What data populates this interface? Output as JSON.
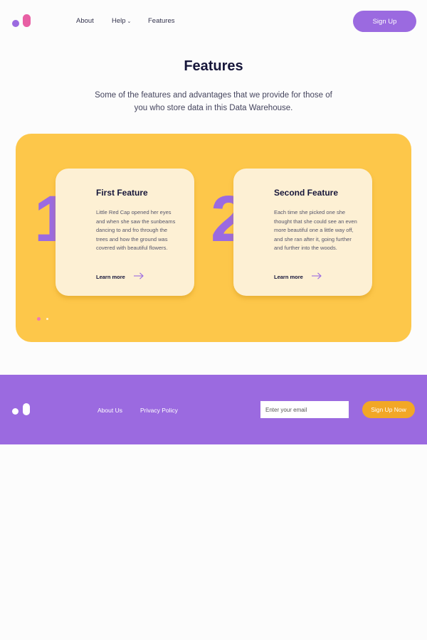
{
  "colors": {
    "purple": "#9b6ae0",
    "pink": "#e85fa4",
    "yellow": "#fdc74a",
    "card": "#fdf0d4",
    "orange": "#f2a726",
    "dot_pink": "#f07ab2",
    "dot_light": "#fff3d6"
  },
  "header": {
    "logo_icon": "logo-icon",
    "nav": [
      "About",
      "Help",
      "Features"
    ],
    "help_icon": "chevron-down-icon",
    "signup_label": "Sign Up"
  },
  "features": {
    "title": "Features",
    "subtitle": "Some of the features and advantages that we provide for those of you who store data in this Data Warehouse.",
    "cards": [
      {
        "number": "1",
        "title": "First Feature",
        "text": "Little Red Cap opened her eyes and when she saw the sunbeams dancing to and fro through the trees and how the ground was covered with beautiful flowers.",
        "link": "Learn more",
        "link_icon": "arrow-right-icon"
      },
      {
        "number": "2",
        "title": "Second Feature",
        "text": "Each time she picked one she thought that she could see an even more beautiful one a little way off, and she ran after it, going further and further into the woods.",
        "link": "Learn more",
        "link_icon": "arrow-right-icon"
      }
    ],
    "carousel": {
      "pages": 2,
      "active": 1
    }
  },
  "footer": {
    "links": [
      "About Us",
      "Privacy Policy"
    ],
    "email_placeholder": "Enter your email",
    "signup_label": "Sign Up Now"
  }
}
